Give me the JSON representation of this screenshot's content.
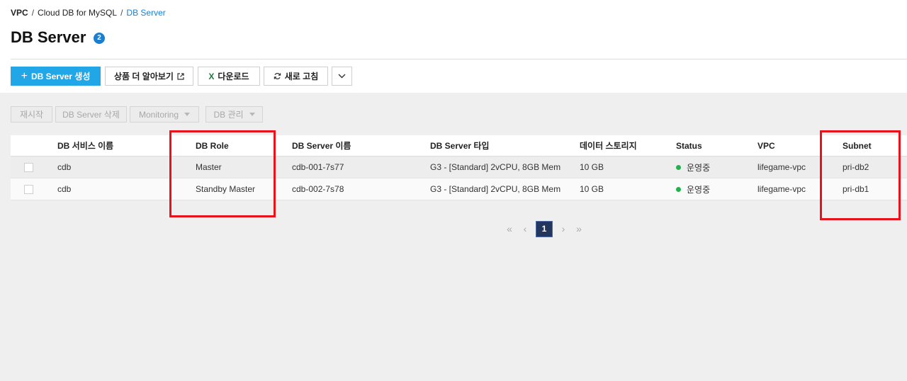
{
  "breadcrumb": [
    "VPC",
    "Cloud DB for MySQL",
    "DB Server"
  ],
  "page": {
    "title": "DB Server",
    "count": "2"
  },
  "toolbar": {
    "create_label": "DB Server 생성",
    "learn_more_label": "상품 더 알아보기",
    "download_label": "다운로드",
    "refresh_label": "새로 고침"
  },
  "actions": {
    "restart_label": "재시작",
    "delete_label": "DB Server 삭제",
    "monitoring_label": "Monitoring",
    "db_manage_label": "DB 관리"
  },
  "table": {
    "columns": [
      "DB 서비스 이름",
      "DB Role",
      "DB Server 이름",
      "DB Server 타입",
      "데이터 스토리지",
      "Status",
      "VPC",
      "Subnet"
    ],
    "rows": [
      {
        "service": "cdb",
        "role": "Master",
        "server": "cdb-001-7s77",
        "type": "G3 - [Standard] 2vCPU, 8GB Mem",
        "storage": "10 GB",
        "status": "운영중",
        "vpc": "lifegame-vpc",
        "subnet": "pri-db2"
      },
      {
        "service": "cdb",
        "role": "Standby Master",
        "server": "cdb-002-7s78",
        "type": "G3 - [Standard] 2vCPU, 8GB Mem",
        "storage": "10 GB",
        "status": "운영중",
        "vpc": "lifegame-vpc",
        "subnet": "pri-db1"
      }
    ]
  },
  "pagination": {
    "current": "1"
  },
  "colors": {
    "primary": "#21a6e8",
    "link": "#1a7fd1",
    "status_ok": "#20b34a",
    "highlight": "#e8131a",
    "page_active": "#23365e"
  }
}
